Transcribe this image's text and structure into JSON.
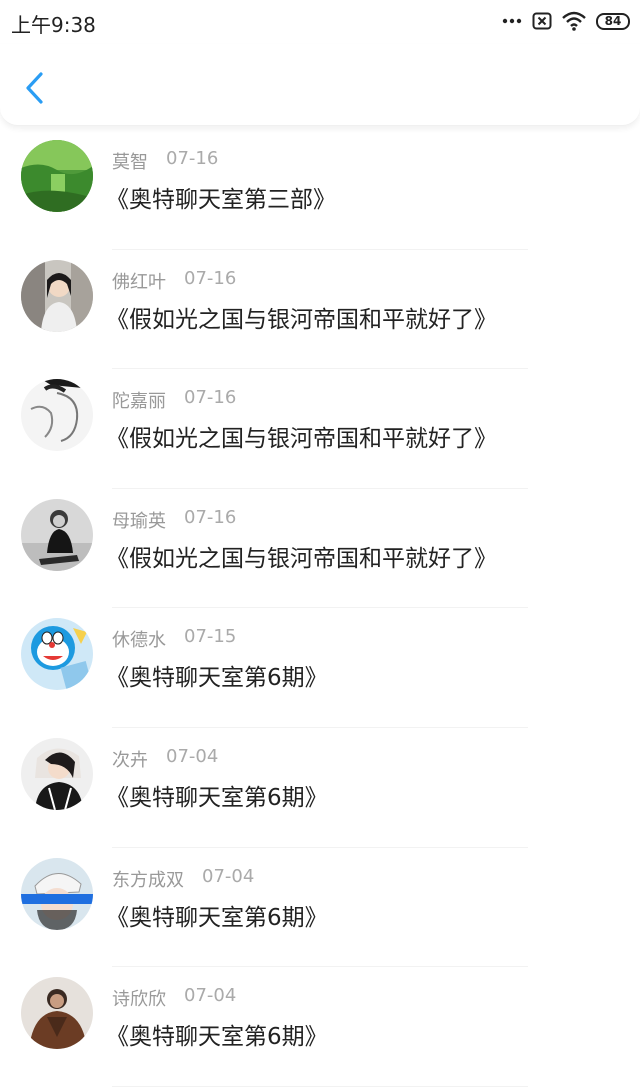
{
  "status_bar": {
    "time": "上午9:38",
    "battery": "84",
    "icons": [
      "more-dots-icon",
      "close-box-icon",
      "wifi-icon",
      "battery-icon"
    ]
  },
  "nav": {
    "back_icon": "chevron-left-icon",
    "accent_color": "#2a9df4"
  },
  "items": [
    {
      "name": "莫智",
      "date": "07-16",
      "title": "《奥特聊天室第三部》"
    },
    {
      "name": "佛红叶",
      "date": "07-16",
      "title": "《假如光之国与银河帝国和平就好了》"
    },
    {
      "name": "陀嘉丽",
      "date": "07-16",
      "title": "《假如光之国与银河帝国和平就好了》"
    },
    {
      "name": "母瑜英",
      "date": "07-16",
      "title": "《假如光之国与银河帝国和平就好了》"
    },
    {
      "name": "休德水",
      "date": "07-15",
      "title": "《奥特聊天室第6期》"
    },
    {
      "name": "次卉",
      "date": "07-04",
      "title": "《奥特聊天室第6期》"
    },
    {
      "name": "东方成双",
      "date": "07-04",
      "title": "《奥特聊天室第6期》"
    },
    {
      "name": "诗欣欣",
      "date": "07-04",
      "title": "《奥特聊天室第6期》"
    }
  ]
}
